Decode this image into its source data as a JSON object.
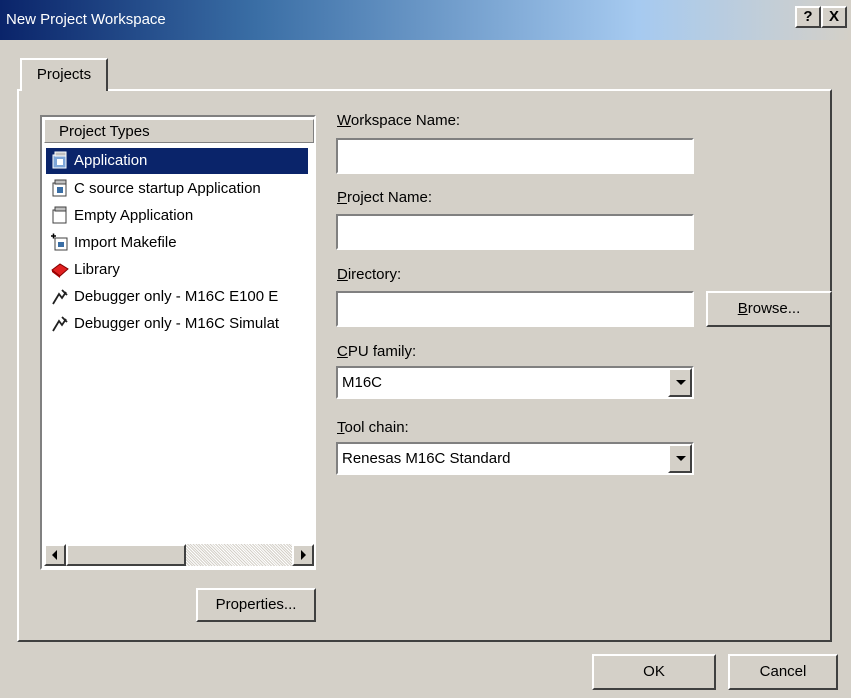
{
  "window": {
    "title": "New Project Workspace",
    "help_btn": "?",
    "close_btn": "X"
  },
  "tabs": [
    {
      "label": "Projects"
    }
  ],
  "project_types": {
    "header": "Project Types",
    "items": [
      {
        "label": "Application",
        "icon": "application-icon",
        "selected": true
      },
      {
        "label": "C source startup Application",
        "icon": "application-icon"
      },
      {
        "label": "Empty Application",
        "icon": "empty-application-icon"
      },
      {
        "label": "Import Makefile",
        "icon": "import-makefile-icon"
      },
      {
        "label": "Library",
        "icon": "library-icon"
      },
      {
        "label": "Debugger only - M16C E100 E",
        "icon": "debugger-icon"
      },
      {
        "label": "Debugger only - M16C Simulat",
        "icon": "debugger-icon"
      }
    ]
  },
  "properties_btn": "Properties...",
  "fields": {
    "workspace_name": {
      "mnemonic": "W",
      "rest": "orkspace Name:",
      "value": ""
    },
    "project_name": {
      "mnemonic": "P",
      "rest": "roject Name:",
      "value": ""
    },
    "directory": {
      "mnemonic": "D",
      "rest": "irectory:",
      "value": ""
    },
    "cpu_family": {
      "mnemonic": "C",
      "rest": "PU family:",
      "value": "M16C"
    },
    "tool_chain": {
      "mnemonic": "T",
      "rest": "ool chain:",
      "value": "Renesas M16C Standard"
    }
  },
  "browse_btn": {
    "mnemonic": "B",
    "rest": "rowse..."
  },
  "ok_btn": "OK",
  "cancel_btn": "Cancel"
}
